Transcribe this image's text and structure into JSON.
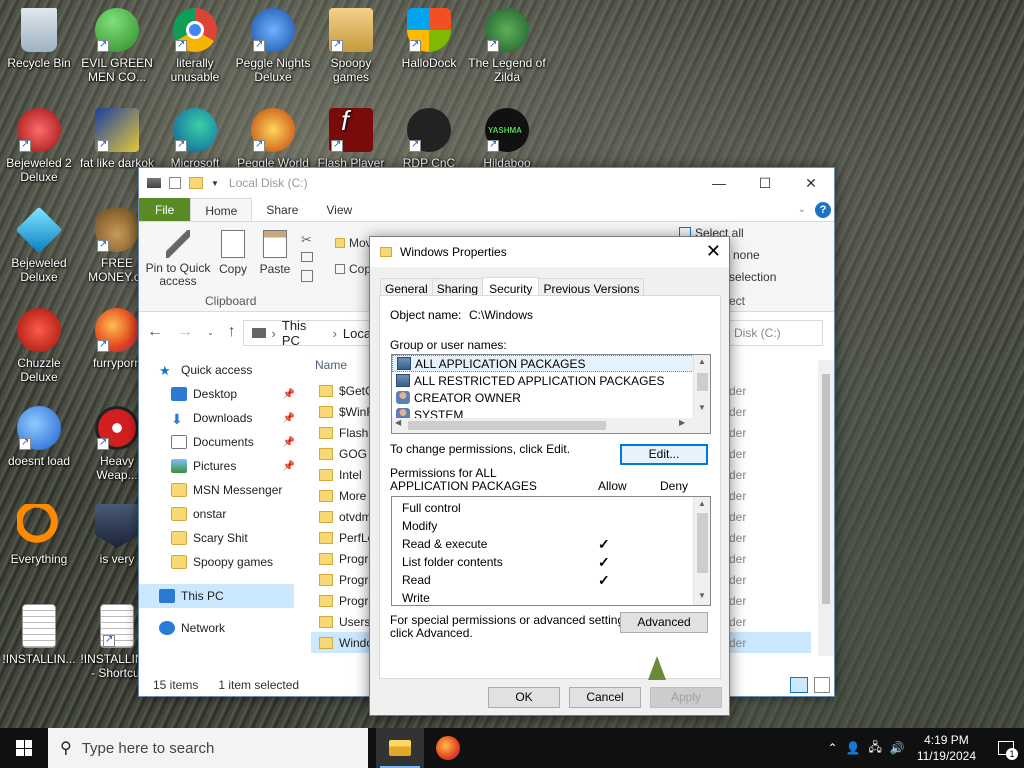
{
  "desktop": {
    "icons": [
      {
        "label": "Recycle Bin"
      },
      {
        "label": "EVIL GREEN MEN CO..."
      },
      {
        "label": "literally unusable"
      },
      {
        "label": "Peggle Nights Deluxe"
      },
      {
        "label": "Spoopy games"
      },
      {
        "label": "HalloDock"
      },
      {
        "label": "The Legend of Zilda"
      },
      {
        "label": "Bejeweled 2 Deluxe"
      },
      {
        "label": "fat like darkok"
      },
      {
        "label": "Microsoft"
      },
      {
        "label": "Peggle World"
      },
      {
        "label": "Flash Player"
      },
      {
        "label": "RDP CnC"
      },
      {
        "label": "Hildaboo"
      },
      {
        "label": "Bejeweled Deluxe"
      },
      {
        "label": "FREE MONEY.cc"
      },
      {
        "label": "Chuzzle Deluxe"
      },
      {
        "label": "furryporn"
      },
      {
        "label": "doesnt load"
      },
      {
        "label": "Heavy Weap..."
      },
      {
        "label": "Everything"
      },
      {
        "label": "is very"
      },
      {
        "label": "!INSTALLIN..."
      },
      {
        "label": "!INSTALLIN... - Shortcut"
      }
    ]
  },
  "explorer": {
    "title": "Local Disk (C:)",
    "tabs": [
      "File",
      "Home",
      "Share",
      "View"
    ],
    "ribbon": {
      "pin_label": "Pin to Quick access",
      "copy_label": "Copy",
      "paste_label": "Paste",
      "clipboard_group": "Clipboard",
      "move_label": "Mov",
      "copyto_label": "Cop",
      "select_all": "Select all",
      "select_none": "none",
      "invert": "selection",
      "select_group": "ect"
    },
    "address": {
      "thispc": "This PC",
      "local": "Local"
    },
    "search_placeholder": "Disk (C:)",
    "nav": {
      "quick_access": "Quick access",
      "desktop": "Desktop",
      "downloads": "Downloads",
      "documents": "Documents",
      "pictures": "Pictures",
      "msn": "MSN Messenger",
      "onstar": "onstar",
      "scary": "Scary Shit",
      "spoopy": "Spoopy games",
      "thispc": "This PC",
      "network": "Network"
    },
    "column_name": "Name",
    "files": [
      {
        "name": "$GetC",
        "type": "der"
      },
      {
        "name": "$WinR",
        "type": "der"
      },
      {
        "name": "Flashp",
        "type": "der"
      },
      {
        "name": "GOG G",
        "type": "der"
      },
      {
        "name": "Intel",
        "type": "der"
      },
      {
        "name": "More o",
        "type": "der"
      },
      {
        "name": "otvdm",
        "type": "der"
      },
      {
        "name": "PerfLo",
        "type": "der"
      },
      {
        "name": "Progra",
        "type": "der"
      },
      {
        "name": "Progra",
        "type": "der"
      },
      {
        "name": "Progra",
        "type": "der"
      },
      {
        "name": "Users",
        "type": "der"
      },
      {
        "name": "Windo",
        "type": "der"
      }
    ],
    "status": {
      "items": "15 items",
      "selected": "1 item selected"
    }
  },
  "dialog": {
    "title": "Windows Properties",
    "tabs": [
      "General",
      "Sharing",
      "Security",
      "Previous Versions"
    ],
    "object_label": "Object name:",
    "object_value": "C:\\Windows",
    "group_label": "Group or user names:",
    "groups": [
      "ALL APPLICATION PACKAGES",
      "ALL RESTRICTED APPLICATION PACKAGES",
      "CREATOR OWNER",
      "SYSTEM"
    ],
    "change_text": "To change permissions, click Edit.",
    "edit_btn": "Edit...",
    "perm_for_1": "Permissions for ALL",
    "perm_for_2": "APPLICATION PACKAGES",
    "allow": "Allow",
    "deny": "Deny",
    "permissions": [
      {
        "name": "Full control",
        "allow": ""
      },
      {
        "name": "Modify",
        "allow": ""
      },
      {
        "name": "Read & execute",
        "allow": "✓"
      },
      {
        "name": "List folder contents",
        "allow": "✓"
      },
      {
        "name": "Read",
        "allow": "✓"
      },
      {
        "name": "Write",
        "allow": ""
      }
    ],
    "special_1": "For special permissions or advanced settings,",
    "special_2": "click Advanced.",
    "advanced_btn": "Advanced",
    "ok": "OK",
    "cancel": "Cancel",
    "apply": "Apply"
  },
  "taskbar": {
    "search_placeholder": "Type here to search",
    "time": "4:19 PM",
    "date": "11/19/2024",
    "notification_count": "1"
  }
}
